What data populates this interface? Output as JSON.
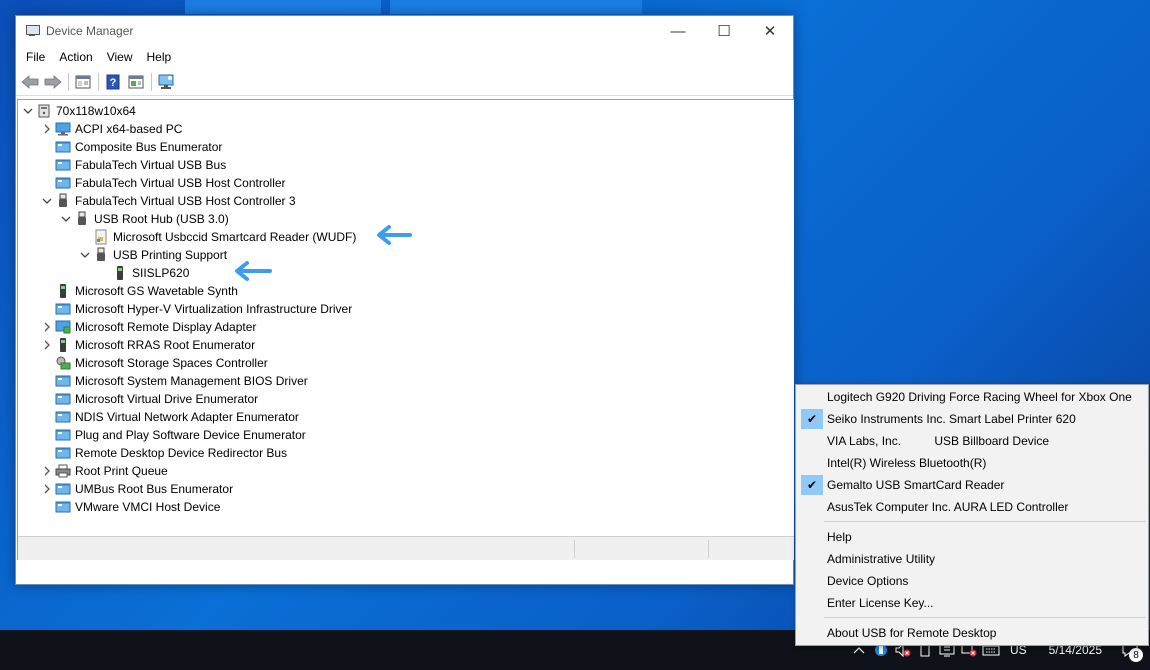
{
  "window": {
    "title": "Device Manager",
    "controls": {
      "minimize": "—",
      "maximize": "☐",
      "close": "✕"
    }
  },
  "menu": [
    "File",
    "Action",
    "View",
    "Help"
  ],
  "toolbar": [
    "back-icon",
    "forward-icon",
    "properties-icon",
    "help-icon",
    "update-driver-icon",
    "scan-hardware-icon"
  ],
  "tree": {
    "root": "70x118w10x64",
    "items": [
      {
        "label": "ACPI x64-based PC",
        "expander": ">",
        "icon": "computer-icon"
      },
      {
        "label": "Composite Bus Enumerator",
        "expander": "",
        "icon": "system-device-icon"
      },
      {
        "label": "FabulaTech Virtual USB Bus",
        "expander": "",
        "icon": "system-device-icon"
      },
      {
        "label": "FabulaTech Virtual USB Host Controller",
        "expander": "",
        "icon": "system-device-icon"
      },
      {
        "label": "FabulaTech Virtual USB Host Controller 3",
        "expander": "v",
        "icon": "usb-icon"
      },
      {
        "label": "USB Root Hub (USB 3.0)",
        "expander": "v",
        "icon": "usb-icon"
      },
      {
        "label": "Microsoft Usbccid Smartcard Reader (WUDF)",
        "expander": "",
        "icon": "smartcard-icon"
      },
      {
        "label": "USB Printing Support",
        "expander": "v",
        "icon": "usb-icon"
      },
      {
        "label": "SIISLP620",
        "expander": "",
        "icon": "generic-device-icon"
      },
      {
        "label": "Microsoft GS Wavetable Synth",
        "expander": "",
        "icon": "generic-device-icon"
      },
      {
        "label": "Microsoft Hyper-V Virtualization Infrastructure Driver",
        "expander": "",
        "icon": "system-device-icon"
      },
      {
        "label": "Microsoft Remote Display Adapter",
        "expander": ">",
        "icon": "display-adapter-icon"
      },
      {
        "label": "Microsoft RRAS Root Enumerator",
        "expander": ">",
        "icon": "generic-device-icon"
      },
      {
        "label": "Microsoft Storage Spaces Controller",
        "expander": "",
        "icon": "storage-controller-icon"
      },
      {
        "label": "Microsoft System Management BIOS Driver",
        "expander": "",
        "icon": "system-device-icon"
      },
      {
        "label": "Microsoft Virtual Drive Enumerator",
        "expander": "",
        "icon": "system-device-icon"
      },
      {
        "label": "NDIS Virtual Network Adapter Enumerator",
        "expander": "",
        "icon": "system-device-icon"
      },
      {
        "label": "Plug and Play Software Device Enumerator",
        "expander": "",
        "icon": "system-device-icon"
      },
      {
        "label": "Remote Desktop Device Redirector Bus",
        "expander": "",
        "icon": "system-device-icon"
      },
      {
        "label": "Root Print Queue",
        "expander": ">",
        "icon": "printer-icon"
      },
      {
        "label": "UMBus Root Bus Enumerator",
        "expander": ">",
        "icon": "system-device-icon"
      },
      {
        "label": "VMware VMCI Host Device",
        "expander": "",
        "icon": "system-device-icon"
      }
    ]
  },
  "context_menu": {
    "devices": [
      {
        "label": "Logitech G920 Driving Force Racing Wheel for Xbox One",
        "checked": false
      },
      {
        "label": "Seiko Instruments Inc. Smart Label Printer 620",
        "checked": true
      },
      {
        "label": "VIA Labs, Inc.          USB Billboard Device",
        "checked": false
      },
      {
        "label": "Intel(R) Wireless Bluetooth(R)",
        "checked": false
      },
      {
        "label": "Gemalto USB SmartCard Reader",
        "checked": true
      },
      {
        "label": "AsusTek Computer Inc. AURA LED Controller",
        "checked": false
      }
    ],
    "actions": [
      "Help",
      "Administrative Utility",
      "Device Options",
      "Enter License Key..."
    ],
    "about": "About USB for Remote Desktop",
    "check_mark": "✔"
  },
  "taskbar": {
    "language": "US",
    "date": "5/14/2025",
    "notification_count": "8",
    "tray_icons": [
      "show-hidden-icons-icon",
      "usb-remote-desktop-icon",
      "volume-muted-icon",
      "battery-icon",
      "network-icon",
      "network-disconnected-icon",
      "keyboard-icon"
    ]
  },
  "colors": {
    "accent": "#0078d7",
    "arrow": "#3b9cf0",
    "menu_check_bg": "#90c8f6"
  }
}
